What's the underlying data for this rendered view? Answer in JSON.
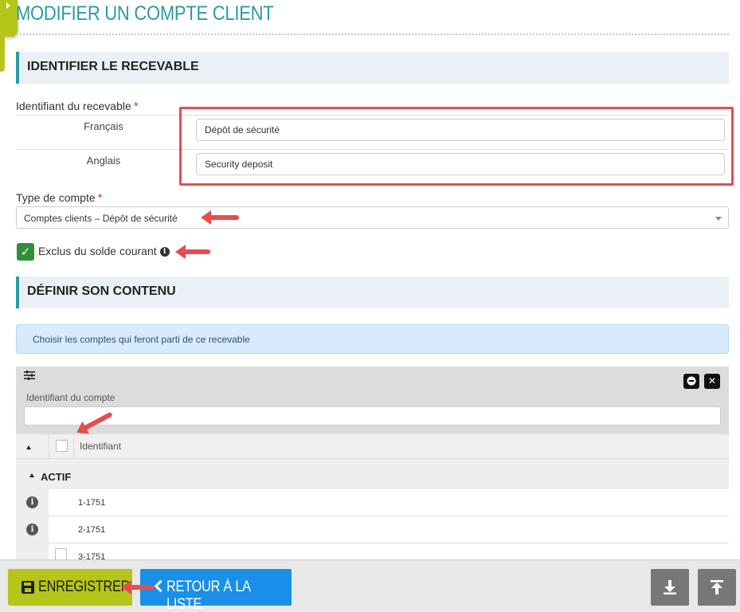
{
  "page": {
    "title": "MODIFIER UN COMPTE CLIENT"
  },
  "section_identify": {
    "title": "IDENTIFIER LE RECEVABLE"
  },
  "receivable_id": {
    "label": "Identifiant du recevable",
    "required_mark": "*",
    "french_label": "Français",
    "french_value": "Dépôt de sécurité",
    "english_label": "Anglais",
    "english_value": "Security deposit"
  },
  "account_type": {
    "label": "Type de compte",
    "required_mark": "*",
    "selected": "Comptes clients – Dépôt de sécurité"
  },
  "excluded": {
    "label": "Exclus du solde courant",
    "checked": true
  },
  "section_content": {
    "title": "DÉFINIR SON CONTENU"
  },
  "info_banner": {
    "text": "Choisir les comptes qui feront parti de ce recevable"
  },
  "grid": {
    "filter_label": "Identifiant du compte",
    "filter_value": "",
    "column_header": "Identifiant",
    "group": "ACTIF",
    "rows": [
      {
        "id": "1-1751",
        "has_info": true
      },
      {
        "id": "2-1751",
        "has_info": true
      },
      {
        "id": "3-1751",
        "has_info": false
      }
    ]
  },
  "footer": {
    "save_label": "ENREGISTRER",
    "back_label": "RETOUR À LA LISTE"
  },
  "icons": {
    "save": "floppy-disk-icon",
    "back": "chevron-left-icon",
    "download": "download-icon",
    "to_top": "arrow-to-top-icon",
    "filter": "sliders-icon",
    "collapse": "minus-circle-icon",
    "close": "close-icon",
    "info": "info-circle-icon"
  },
  "colors": {
    "accent_teal": "#2a9aa6",
    "brand_green": "#b5c51a",
    "primary_blue": "#1a8fe8",
    "annotation_red": "#e74c4f",
    "check_green": "#2f8f3a"
  }
}
